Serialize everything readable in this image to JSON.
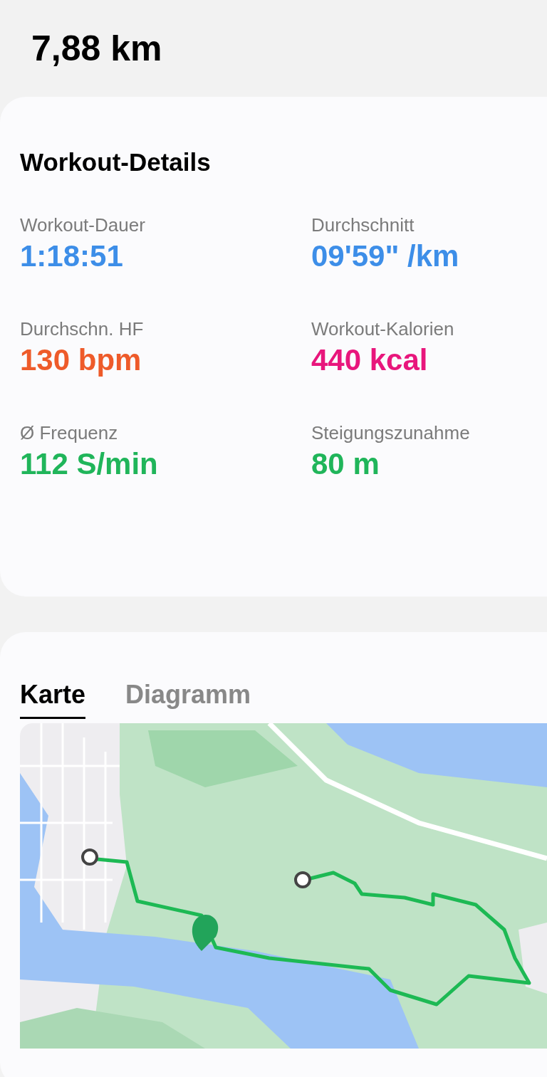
{
  "distance": "7,88 km",
  "details": {
    "title": "Workout-Details",
    "metrics": [
      {
        "label": "Workout-Dauer",
        "value": "1:18:51",
        "color": "#3d8ee8"
      },
      {
        "label": "Durchschnitt",
        "value": "09'59\" /km",
        "color": "#3d8ee8"
      },
      {
        "label": "Durchschn. HF",
        "value": "130 bpm",
        "color": "#ee5b2a"
      },
      {
        "label": "Workout-Kalorien",
        "value": "440 kcal",
        "color": "#e8167c"
      },
      {
        "label": "Ø Frequenz",
        "value": "112 S/min",
        "color": "#20b55a"
      },
      {
        "label": "Steigungszunahme",
        "value": "80 m",
        "color": "#20b55a"
      }
    ]
  },
  "tabs": [
    {
      "label": "Karte",
      "selected": true
    },
    {
      "label": "Diagramm",
      "selected": false
    }
  ]
}
